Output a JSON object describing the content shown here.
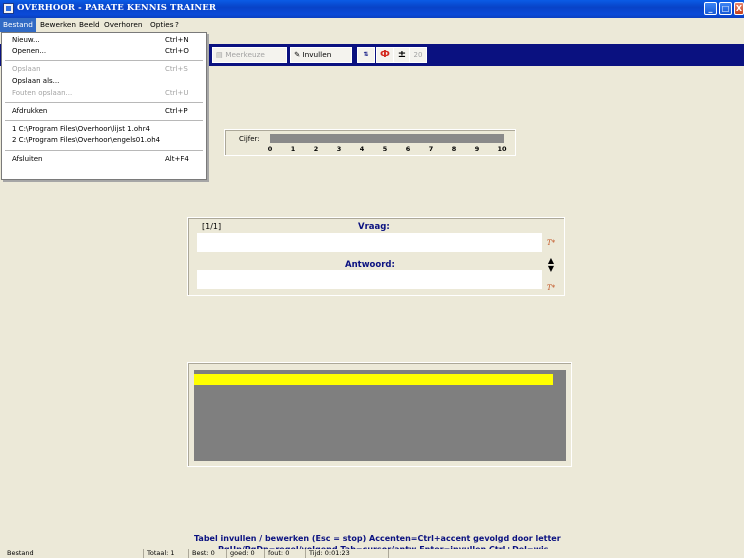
{
  "window": {
    "title": "OVERHOOR - PARATE KENNIS TRAINER",
    "minimize": "_",
    "maximize": "□",
    "close": "X"
  },
  "menu": {
    "items": [
      "Bestand",
      "Bewerken",
      "Beeld",
      "Overhoren",
      "Opties",
      "?"
    ]
  },
  "file_menu": {
    "items": [
      {
        "label": "Nieuw...",
        "shortcut": "Ctrl+N",
        "enabled": true
      },
      {
        "label": "Openen...",
        "shortcut": "Ctrl+O",
        "enabled": true
      },
      {
        "label": "Opslaan",
        "shortcut": "Ctrl+S",
        "enabled": false
      },
      {
        "label": "Opslaan als...",
        "shortcut": "",
        "enabled": true
      },
      {
        "label": "Fouten opslaan...",
        "shortcut": "Ctrl+U",
        "enabled": false
      },
      {
        "label": "Afdrukken",
        "shortcut": "Ctrl+P",
        "enabled": true
      },
      {
        "label": "1 C:\\Program Files\\Overhoor\\lijst 1.ohr4",
        "shortcut": "",
        "enabled": true
      },
      {
        "label": "2 C:\\Program Files\\Overhoor\\engels01.oh4",
        "shortcut": "",
        "enabled": true
      },
      {
        "label": "Afsluiten",
        "shortcut": "Alt+F4",
        "enabled": true
      }
    ]
  },
  "toolbar": {
    "meerkeuze": "Meerkeuze",
    "invullen": "Invullen",
    "btn_a": "⇅",
    "btn_b": "Ф",
    "btn_c": "±",
    "btn_d": "20"
  },
  "cijfer": {
    "label": "Cijfer:",
    "ticks": [
      "0",
      "1",
      "2",
      "3",
      "4",
      "5",
      "6",
      "7",
      "8",
      "9",
      "10"
    ]
  },
  "question": {
    "counter": "[1/1]",
    "vraag_label": "Vraag:",
    "antwoord_label": "Antwoord:",
    "vraag_value": "",
    "antwoord_value": "",
    "accent_icon": "T*"
  },
  "progress": {
    "fraction": 0.965
  },
  "hints": {
    "line1": "Tabel invullen / bewerken (Esc = stop) Accenten=Ctrl+accent gevolgd door letter",
    "line2": "PgUp/PgDn=regel/volgend  Tab=cursor/antw  Enter=invullen  Ctrl+Del=wis"
  },
  "status": {
    "cells": [
      "Bestand",
      "Totaal: 1",
      "Best: 0",
      "goed: 0",
      "fout: 0",
      "Tijd: 0:01:23"
    ]
  },
  "colors": {
    "title_blue": "#0a4ad8",
    "toolbar_navy": "#0a1180",
    "progress_yellow": "#ffff00",
    "bar_gray": "#7f7f7f"
  }
}
